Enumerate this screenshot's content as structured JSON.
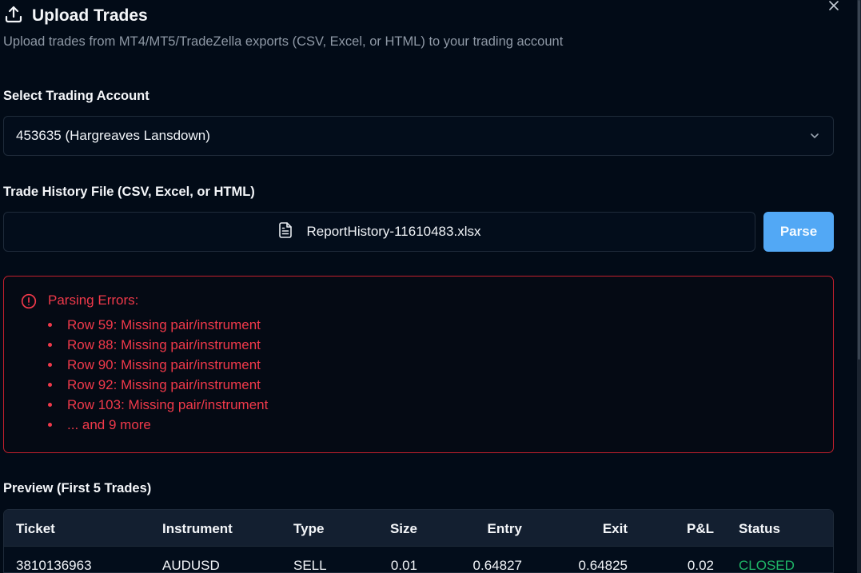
{
  "dialog": {
    "title": "Upload Trades",
    "subtitle": "Upload trades from MT4/MT5/TradeZella exports (CSV, Excel, or HTML) to your trading account",
    "icons": {
      "title": "upload-icon",
      "close": "close-icon"
    }
  },
  "account": {
    "label": "Select Trading Account",
    "selected": "453635 (Hargreaves Lansdown)",
    "icon": "chevron-down-icon"
  },
  "file": {
    "label": "Trade History File (CSV, Excel, or HTML)",
    "name": "ReportHistory-11610483.xlsx",
    "icon": "file-text-icon",
    "parse_label": "Parse"
  },
  "errors": {
    "title": "Parsing Errors:",
    "icon": "alert-circle-icon",
    "items": [
      "Row 59: Missing pair/instrument",
      "Row 88: Missing pair/instrument",
      "Row 90: Missing pair/instrument",
      "Row 92: Missing pair/instrument",
      "Row 103: Missing pair/instrument",
      "... and 9 more"
    ]
  },
  "preview": {
    "label": "Preview (First 5 Trades)",
    "columns": {
      "ticket": "Ticket",
      "instrument": "Instrument",
      "type": "Type",
      "size": "Size",
      "entry": "Entry",
      "exit": "Exit",
      "pnl": "P&L",
      "status": "Status"
    },
    "rows": [
      {
        "ticket": "3810136963",
        "instrument": "AUDUSD",
        "type": "SELL",
        "size": "0.01",
        "entry": "0.64827",
        "exit": "0.64825",
        "pnl": "0.02",
        "status": "CLOSED"
      }
    ]
  },
  "colors": {
    "background": "#020b17",
    "accent": "#52a8f5",
    "error": "#f0394a",
    "status_closed": "#1fb768"
  }
}
